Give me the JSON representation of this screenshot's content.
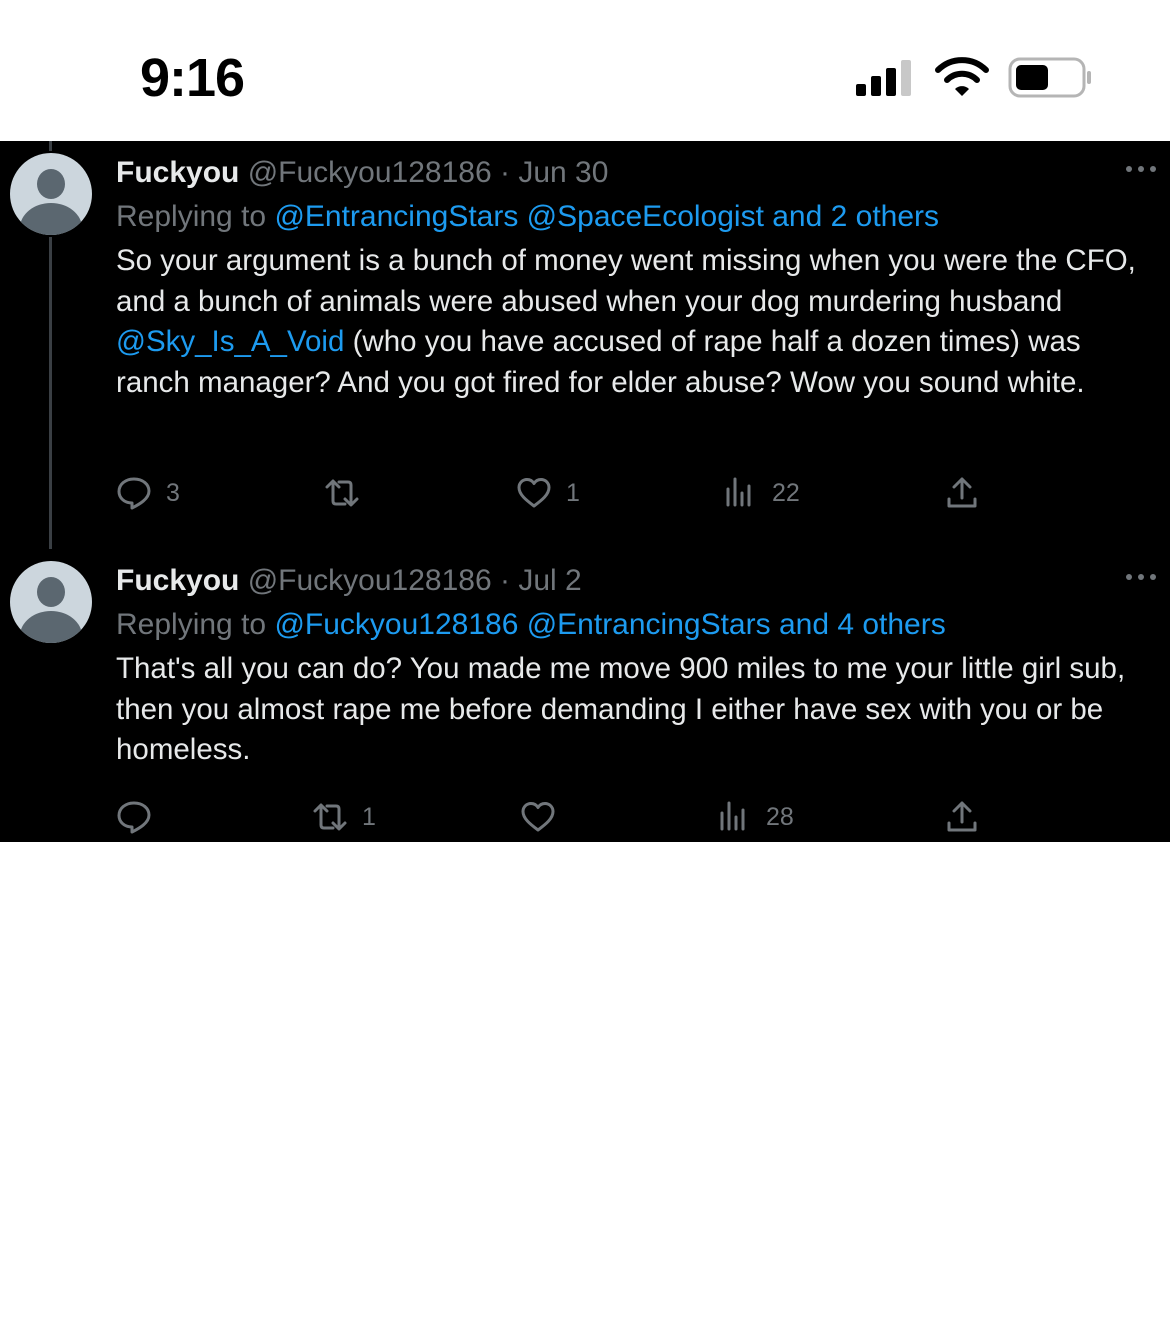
{
  "status_bar": {
    "time": "9:16"
  },
  "tweets": [
    {
      "display_name": "Fuckyou",
      "handle": "@Fuckyou128186",
      "separator": "·",
      "date": "Jun 30",
      "replying_prefix": "Replying to",
      "replying_mentions": "@EntrancingStars @SpaceEcologist and 2 others",
      "body_before_mention": "So your argument is a bunch of money went missing when you were the CFO, and a bunch of animals were abused when your dog murdering husband ",
      "body_mention": "@Sky_Is_A_Void",
      "body_after_mention": " (who you have accused of rape half a dozen times) was ranch manager? And you got fired for elder abuse? Wow you sound white.",
      "replies": "3",
      "retweets": "",
      "likes": "1",
      "views": "22"
    },
    {
      "display_name": "Fuckyou",
      "handle": "@Fuckyou128186",
      "separator": "·",
      "date": "Jul 2",
      "replying_prefix": "Replying to",
      "replying_mentions": "@Fuckyou128186 @EntrancingStars and 4 others",
      "body": "That's all you can do? You made me move 900 miles to me your little girl sub, then you almost rape me before demanding I either have sex with you or be homeless.",
      "replies": "",
      "retweets": "1",
      "likes": "",
      "views": "28"
    }
  ],
  "colors": {
    "background": "#000000",
    "text": "#e7e9ea",
    "muted": "#71767b",
    "link": "#1d9bf0"
  },
  "icons": [
    "cellular-signal-icon",
    "wifi-icon",
    "battery-icon",
    "default-avatar-icon",
    "more-icon",
    "reply-icon",
    "retweet-icon",
    "like-icon",
    "views-icon",
    "share-icon"
  ]
}
